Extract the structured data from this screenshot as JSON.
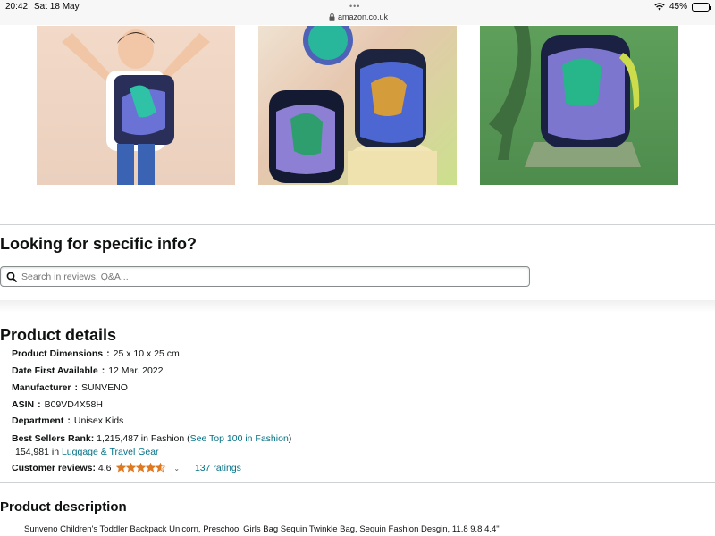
{
  "status_bar": {
    "time": "20:42",
    "date": "Sat 18 May",
    "url": "amazon.co.uk",
    "battery": "45%",
    "battery_level": 0.45
  },
  "gallery": {
    "images": [
      {
        "icon": "child-with-backpack-photo"
      },
      {
        "icon": "backpacks-on-podium-photo"
      },
      {
        "icon": "backpack-with-dinosaur-photo"
      }
    ]
  },
  "info_section": {
    "title": "Looking for specific info?",
    "search_placeholder": "Search in reviews, Q&A..."
  },
  "product_details": {
    "title": "Product details",
    "rows": [
      {
        "label": "Product Dimensions",
        "sep": ":",
        "value": "25 x 10 x 25 cm"
      },
      {
        "label": "Date First Available",
        "sep": ":",
        "value": "12 Mar. 2022"
      },
      {
        "label": "Manufacturer",
        "sep": ":",
        "value": "SUNVENO"
      },
      {
        "label": "ASIN",
        "sep": ":",
        "value": "B09VD4X58H"
      },
      {
        "label": "Department",
        "sep": ":",
        "value": "Unisex Kids"
      }
    ],
    "best_sellers": {
      "label": "Best Sellers Rank:",
      "rank1": "1,215,487 in Fashion (",
      "rank1_link": "See Top 100 in Fashion",
      "rank1_close": ")",
      "rank2": "154,981 in ",
      "rank2_link": "Luggage & Travel Gear"
    },
    "reviews": {
      "label": "Customer reviews:",
      "score": "4.6",
      "rating": 4.6,
      "ratings_count": "137 ratings",
      "star_color": "#de7921"
    }
  },
  "description": {
    "title": "Product description",
    "text": "Sunveno Children's Toddler Backpack Unicorn, Preschool Girls Bag Sequin Twinkle Bag, Sequin Fashion Desgin, 11.8 9.8 4.4\""
  },
  "colors": {
    "link": "#007185",
    "text": "#0f1111"
  }
}
